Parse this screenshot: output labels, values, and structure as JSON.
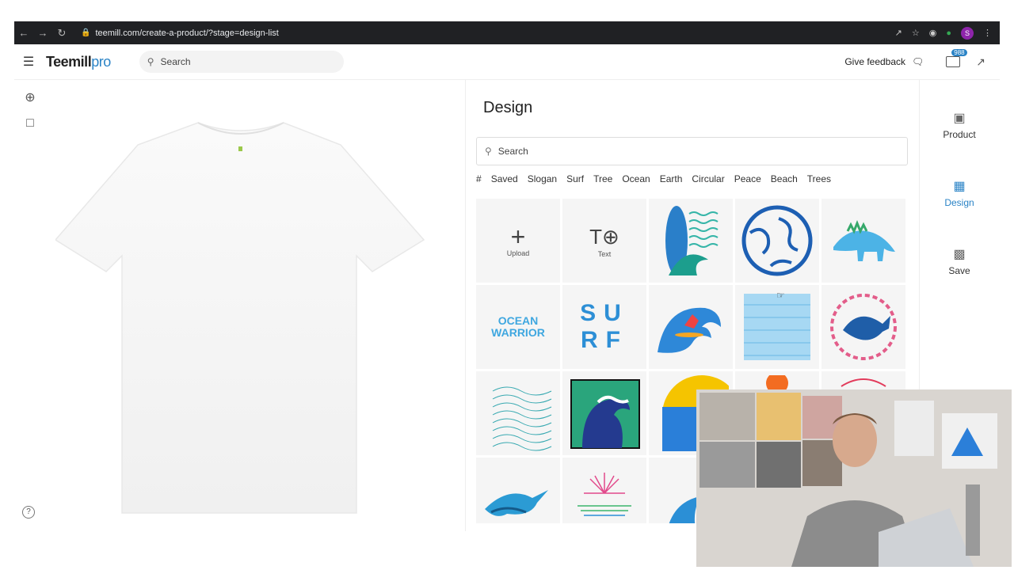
{
  "browser": {
    "url": "teemill.com/create-a-product/?stage=design-list",
    "profile_initial": "S"
  },
  "topbar": {
    "logo_main": "Teemill",
    "logo_sub": "pro",
    "search_placeholder": "Search",
    "feedback_label": "Give feedback",
    "mail_badge": "988"
  },
  "design": {
    "title": "Design",
    "search_placeholder": "Search",
    "tags": [
      "#",
      "Saved",
      "Slogan",
      "Surf",
      "Tree",
      "Ocean",
      "Earth",
      "Circular",
      "Peace",
      "Beach",
      "Trees"
    ],
    "upload_label": "Upload",
    "text_label": "Text",
    "surf_text": "SURF",
    "ocean_warrior_text": "OCEAN WARRIOR"
  },
  "sidebar": {
    "product_label": "Product",
    "design_label": "Design",
    "save_label": "Save"
  },
  "colors": {
    "accent": "#2a83c6",
    "browser_bar": "#202124"
  }
}
